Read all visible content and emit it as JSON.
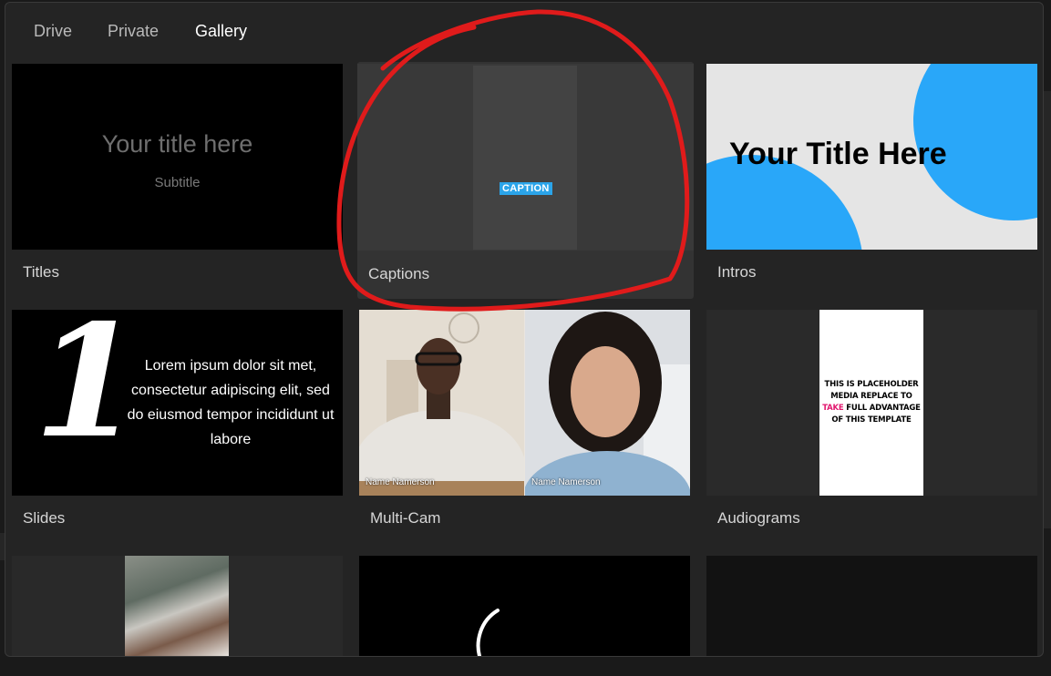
{
  "tabs": [
    {
      "label": "Drive",
      "active": false
    },
    {
      "label": "Private",
      "active": false
    },
    {
      "label": "Gallery",
      "active": true
    }
  ],
  "cards": {
    "titles": {
      "label": "Titles",
      "thumb_title": "Your title here",
      "thumb_subtitle": "Subtitle"
    },
    "captions": {
      "label": "Captions",
      "thumb_caption": "CAPTION"
    },
    "intros": {
      "label": "Intros",
      "thumb_title": "Your Title Here"
    },
    "slides": {
      "label": "Slides",
      "thumb_number": "1",
      "thumb_text": "Lorem ipsum dolor sit met, consectetur adipiscing elit, sed do eiusmod tempor incididunt ut labore"
    },
    "multicam": {
      "label": "Multi-Cam",
      "left_name": "Name Namerson",
      "right_name": "Name Namerson"
    },
    "audiograms": {
      "label": "Audiograms",
      "line1": "THIS IS PLACEHOLDER",
      "line2": "MEDIA REPLACE TO",
      "line3_highlight": "TAKE",
      "line3_rest": " FULL ADVANTAGE",
      "line4": "OF THIS TEMPLATE"
    }
  },
  "colors": {
    "accent_blue": "#2ba4e9",
    "intro_circle": "#29a7f9",
    "highlight_pink": "#e2186f",
    "annotation_red": "#e01b1b"
  }
}
